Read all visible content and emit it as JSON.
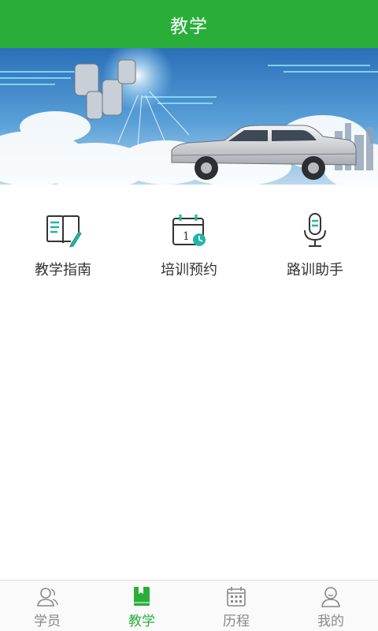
{
  "header": {
    "title": "教学"
  },
  "banner": {
    "alt": ""
  },
  "features": [
    {
      "label": "教学指南",
      "icon": "guide-book-icon"
    },
    {
      "label": "培训预约",
      "icon": "calendar-icon"
    },
    {
      "label": "路训助手",
      "icon": "microphone-icon"
    }
  ],
  "tabs": [
    {
      "label": "学员",
      "icon": "student-icon",
      "active": false
    },
    {
      "label": "教学",
      "icon": "teaching-book-icon",
      "active": true
    },
    {
      "label": "历程",
      "icon": "history-calendar-icon",
      "active": false
    },
    {
      "label": "我的",
      "icon": "profile-icon",
      "active": false
    }
  ],
  "colors": {
    "brand": "#2aae3a",
    "accent_teal": "#22b5a6",
    "text": "#333333",
    "tab_inactive": "#888888"
  }
}
